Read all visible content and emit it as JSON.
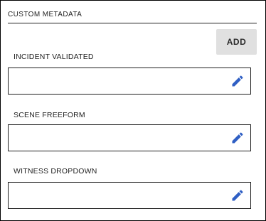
{
  "section": {
    "title": "CUSTOM METADATA"
  },
  "add_button": {
    "label": "ADD"
  },
  "fields": [
    {
      "label": "INCIDENT VALIDATED",
      "value": ""
    },
    {
      "label": "SCENE FREEFORM",
      "value": ""
    },
    {
      "label": "WITNESS DROPDOWN",
      "value": ""
    }
  ],
  "icons": {
    "edit": "pencil-icon"
  },
  "colors": {
    "accent": "#2f5fc4",
    "button_bg": "#e0e0e0",
    "border": "#1f1f1f"
  }
}
